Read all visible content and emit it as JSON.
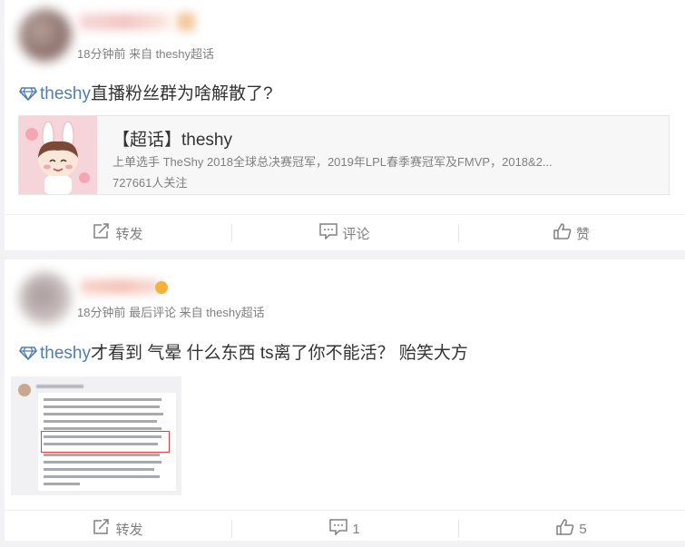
{
  "posts": [
    {
      "meta": "18分钟前 来自 theshy超话",
      "topic_link": "theshy",
      "text": "直播粉丝群为啥解散了?",
      "chaohua": {
        "title": "【超话】theshy",
        "desc": "上单选手 TheShy 2018全球总决赛冠军，2019年LPL春季赛冠军及FMVP，2018&2...",
        "followers": "727661人关注"
      },
      "actions": [
        {
          "icon": "share-icon",
          "label": "转发"
        },
        {
          "icon": "comment-icon",
          "label": "评论"
        },
        {
          "icon": "like-icon",
          "label": "赞"
        }
      ]
    },
    {
      "meta": "18分钟前 最后评论 来自 theshy超话",
      "topic_link": "theshy",
      "text": "才看到 气晕 什么东西 ts离了你不能活？ 贻笑大方",
      "actions": [
        {
          "icon": "share-icon",
          "label": "转发"
        },
        {
          "icon": "comment-icon",
          "label": "1"
        },
        {
          "icon": "like-icon",
          "label": "5"
        }
      ]
    }
  ],
  "colors": {
    "link": "#507daf",
    "meta": "#808080",
    "accent_red": "#e04040"
  }
}
